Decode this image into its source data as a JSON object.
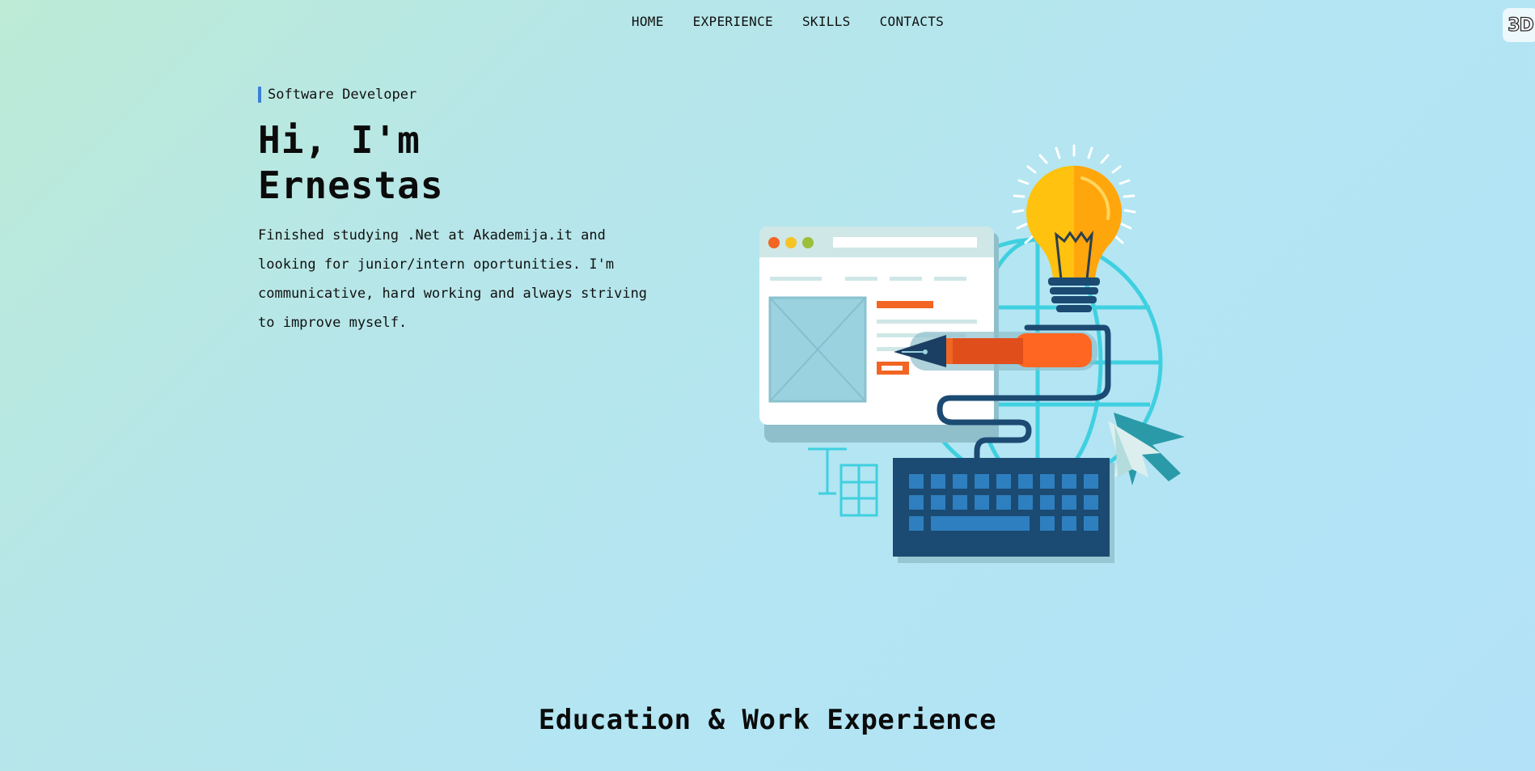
{
  "nav": {
    "items": [
      {
        "label": "HOME"
      },
      {
        "label": "EXPERIENCE"
      },
      {
        "label": "SKILLS"
      },
      {
        "label": "CONTACTS"
      }
    ]
  },
  "badge": {
    "label": "3D"
  },
  "hero": {
    "role": "Software Developer",
    "title_line1": "Hi, I'm",
    "title_line2": "Ernestas",
    "description": "Finished studying .Net at Akademija.it and looking for junior/intern oportunities. I'm communicative, hard working and always striving to improve myself.",
    "illustration_icon": "web-development-illustration"
  },
  "section": {
    "title": "Education & Work Experience"
  },
  "colors": {
    "accent_bar": "#3b7fd9",
    "orange": "#f26522",
    "navy": "#1b4a72",
    "cyan": "#3fd0e0",
    "bulb_yellow": "#ffc20e"
  }
}
